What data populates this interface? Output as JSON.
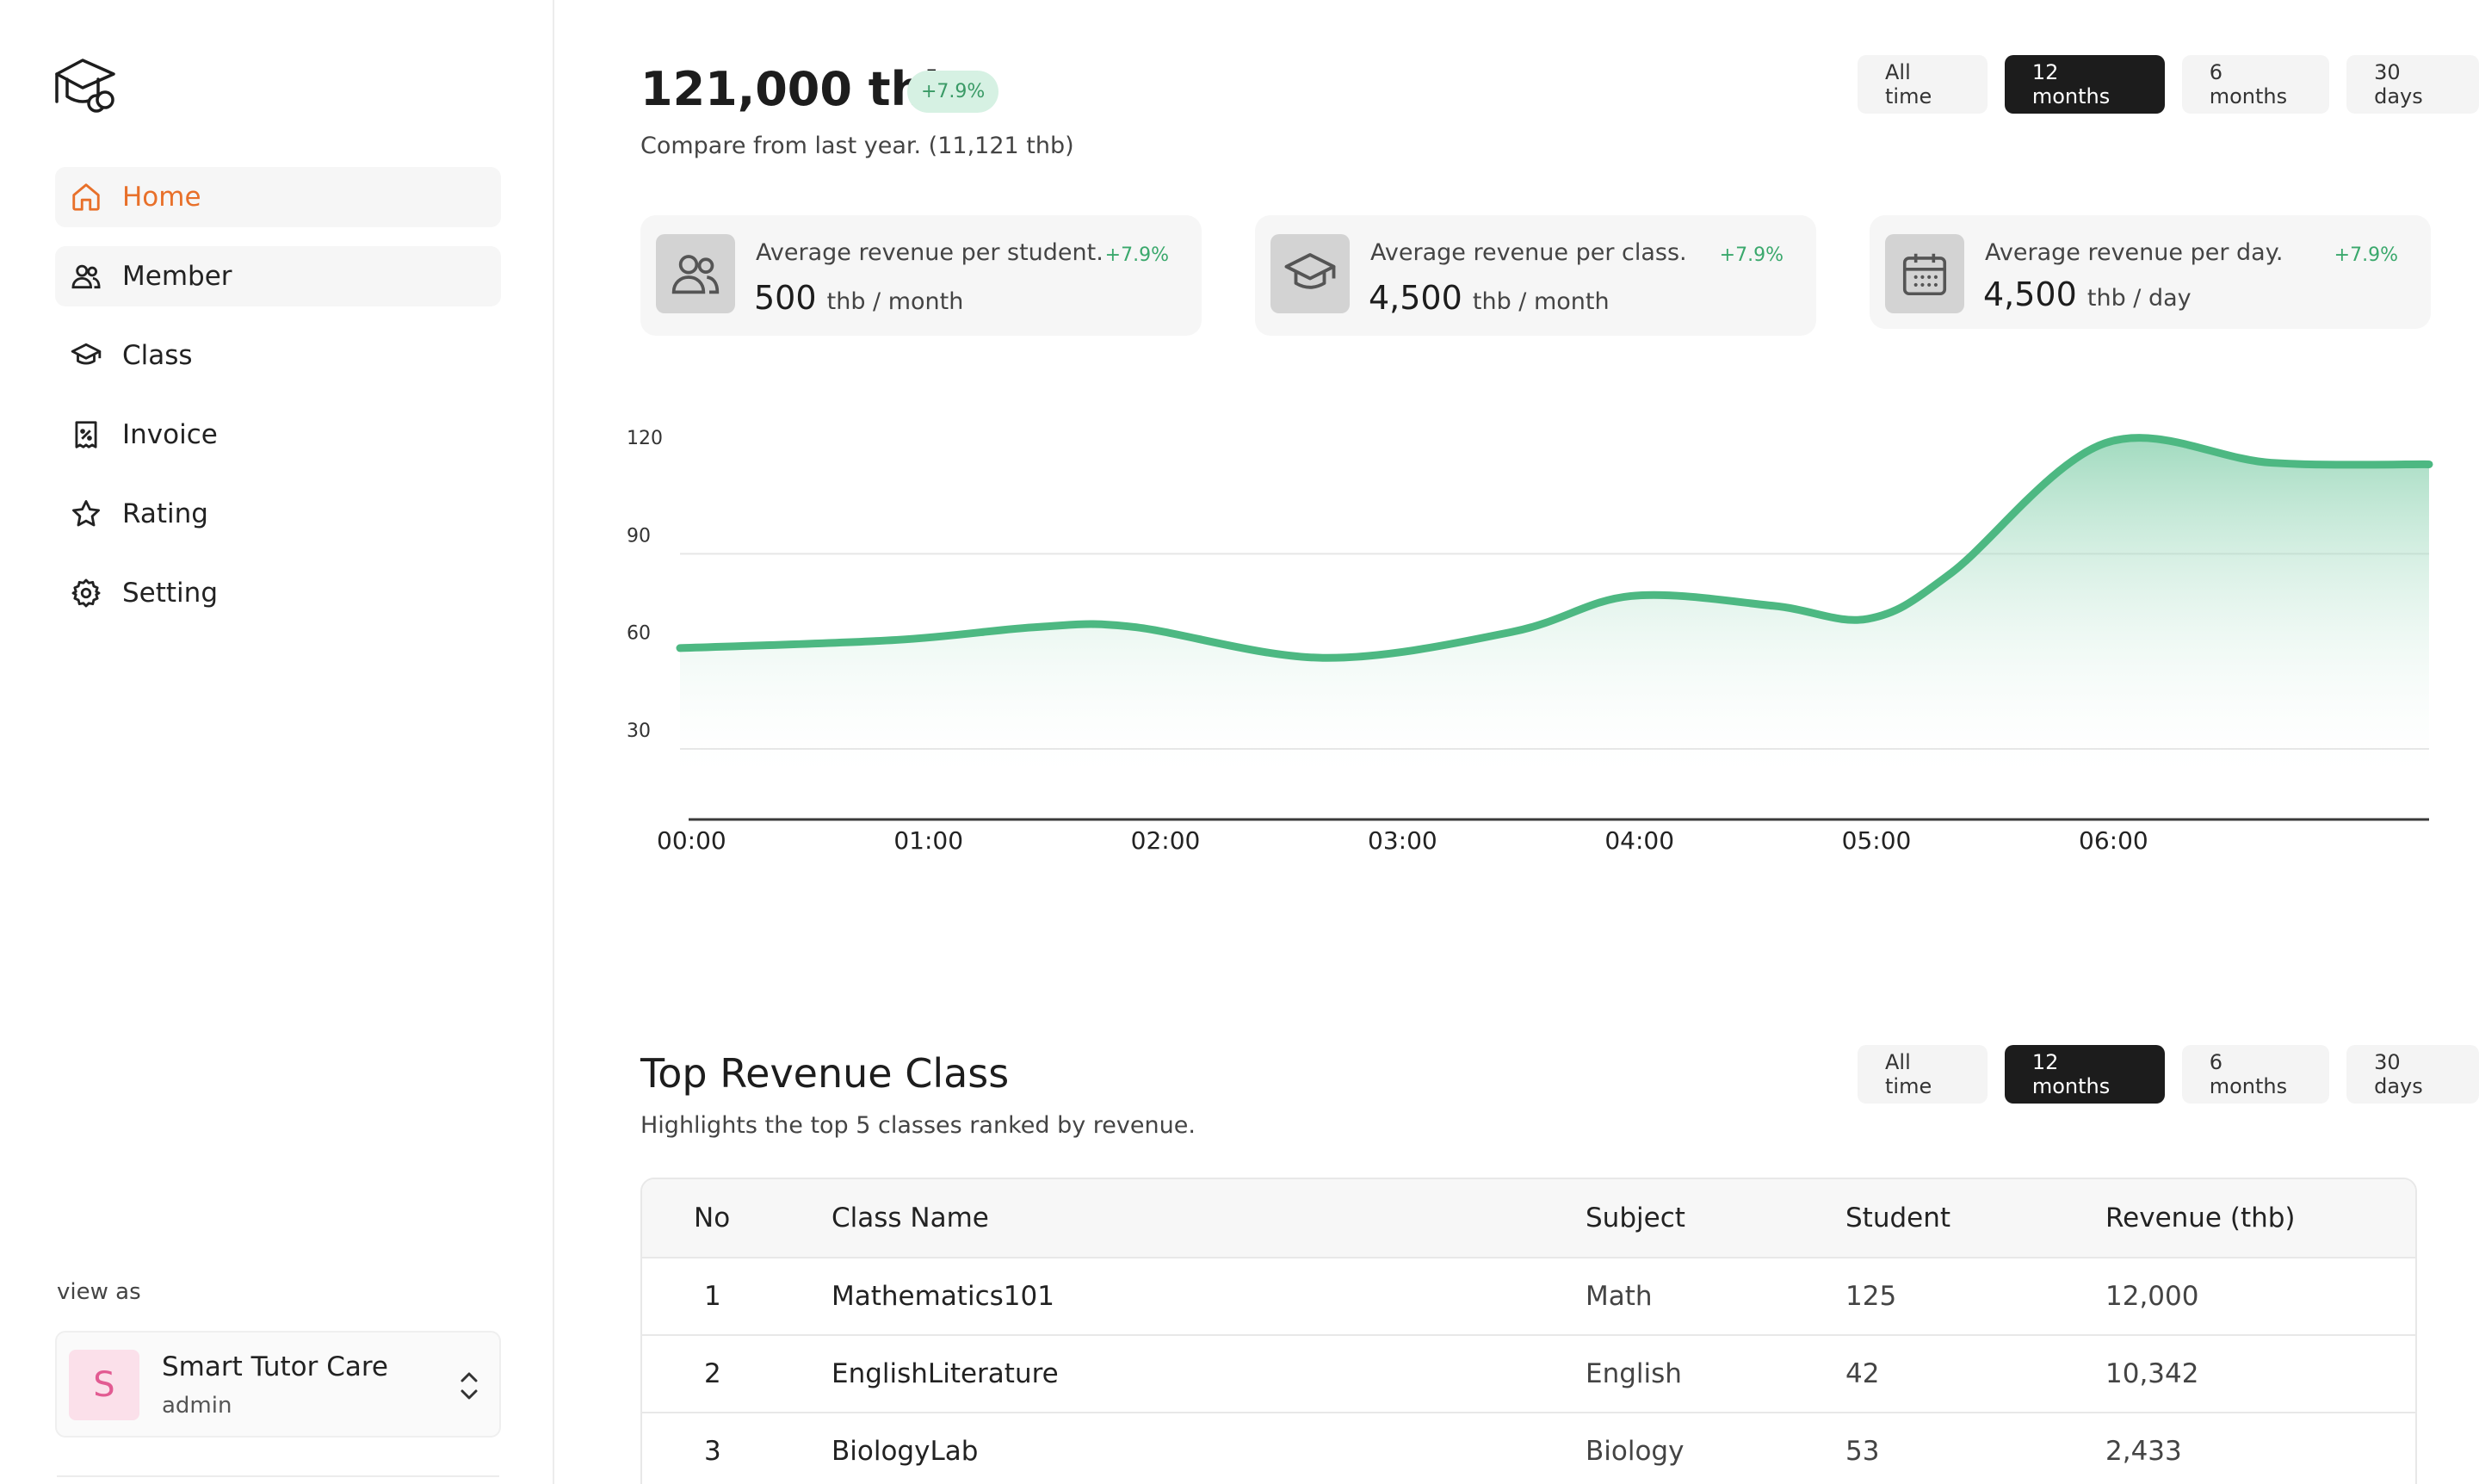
{
  "sidebar": {
    "items": [
      {
        "label": "Home",
        "icon": "home-icon",
        "active": true
      },
      {
        "label": "Member",
        "icon": "users-icon"
      },
      {
        "label": "Class",
        "icon": "graduation-cap-icon"
      },
      {
        "label": "Invoice",
        "icon": "receipt-icon"
      },
      {
        "label": "Rating",
        "icon": "star-icon"
      },
      {
        "label": "Setting",
        "icon": "gear-icon"
      }
    ],
    "view_as_label": "view as",
    "user": {
      "initial": "S",
      "name": "Smart Tutor Care",
      "role": "admin"
    }
  },
  "summary": {
    "total": "121,000 thb",
    "change": "+7.9%",
    "compare_text": "Compare from last year. (11,121 thb)",
    "ranges": [
      "All time",
      "12 months",
      "6 months",
      "30 days"
    ],
    "active_range": "12 months"
  },
  "stats": [
    {
      "title": "Average revenue per student.",
      "value": "500",
      "unit": "thb / month",
      "change": "+7.9%",
      "icon": "users-icon"
    },
    {
      "title": "Average revenue per class.",
      "value": "4,500",
      "unit": "thb / month",
      "change": "+7.9%",
      "icon": "graduation-cap-icon"
    },
    {
      "title": "Average revenue per day.",
      "value": "4,500",
      "unit": "thb / day",
      "change": "+7.9%",
      "icon": "calendar-icon"
    }
  ],
  "chart_data": {
    "type": "area",
    "x": [
      "00:00",
      "01:00",
      "02:00",
      "03:00",
      "04:00",
      "05:00",
      "06:00"
    ],
    "y_ticks": [
      120,
      90,
      60,
      30
    ],
    "ylim": [
      30,
      120
    ],
    "grid": true,
    "series": [
      {
        "color": "#4db882",
        "points": [
          {
            "x": 0,
            "y": 61
          },
          {
            "x": 0.6,
            "y": 63.5
          },
          {
            "x": 1.2,
            "y": 67.5
          },
          {
            "x": 1.6,
            "y": 67.5
          },
          {
            "x": 2.4,
            "y": 58
          },
          {
            "x": 3.2,
            "y": 66
          },
          {
            "x": 3.7,
            "y": 77
          },
          {
            "x": 4.3,
            "y": 74
          },
          {
            "x": 4.7,
            "y": 70
          },
          {
            "x": 5.05,
            "y": 84
          },
          {
            "x": 5.7,
            "y": 124
          },
          {
            "x": 6.4,
            "y": 118
          },
          {
            "x": 6.83,
            "y": 117.5
          }
        ]
      }
    ]
  },
  "top_classes": {
    "title": "Top Revenue Class",
    "subtitle": "Highlights the top 5 classes ranked by revenue.",
    "ranges": [
      "All time",
      "12 months",
      "6 months",
      "30 days"
    ],
    "active_range": "12 months",
    "columns": [
      "No",
      "Class Name",
      "Subject",
      "Student",
      "Revenue (thb)"
    ],
    "rows": [
      [
        "1",
        "Mathematics101",
        "Math",
        "125",
        "12,000"
      ],
      [
        "2",
        "EnglishLiterature",
        "English",
        "42",
        "10,342"
      ],
      [
        "3",
        "BiologyLab",
        "Biology",
        "53",
        "2,433"
      ]
    ]
  }
}
